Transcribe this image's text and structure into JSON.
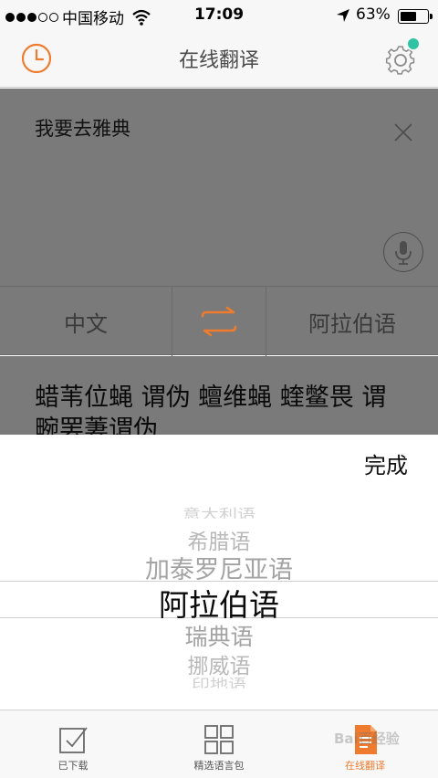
{
  "status_bar": {
    "carrier": "中国移动",
    "time": "17:09",
    "battery_text": "63%",
    "battery_level": 0.63,
    "signal_strength": 3,
    "signal_max": 5
  },
  "nav": {
    "title": "在线翻译",
    "left_icon": "clock-icon",
    "right_icon": "gear-icon",
    "notification_color": "#2fc3a4"
  },
  "input": {
    "text": "我要去雅典"
  },
  "languages": {
    "source": "中文",
    "target": "阿拉伯语",
    "swap_icon": "swap-arrows-icon"
  },
  "result": {
    "text": "蜡苇位蝇 谓伪 蟺维蝇 蝰鳖畏 谓 畹罢萋谓伪"
  },
  "picker": {
    "done_label": "完成",
    "options": [
      "意大利语",
      "希腊语",
      "加泰罗尼亚语",
      "阿拉伯语",
      "瑞典语",
      "挪威语",
      "印地语"
    ],
    "selected": "阿拉伯语"
  },
  "tabs": [
    {
      "label": "已下载",
      "icon": "checkbox-icon",
      "active": false
    },
    {
      "label": "精选语言包",
      "icon": "grid-icon",
      "active": false
    },
    {
      "label": "在线翻译",
      "icon": "document-icon",
      "active": true
    }
  ],
  "colors": {
    "accent": "#ef7b2e",
    "overlay": "#7a7a7a"
  },
  "watermark": "Bai百经验"
}
